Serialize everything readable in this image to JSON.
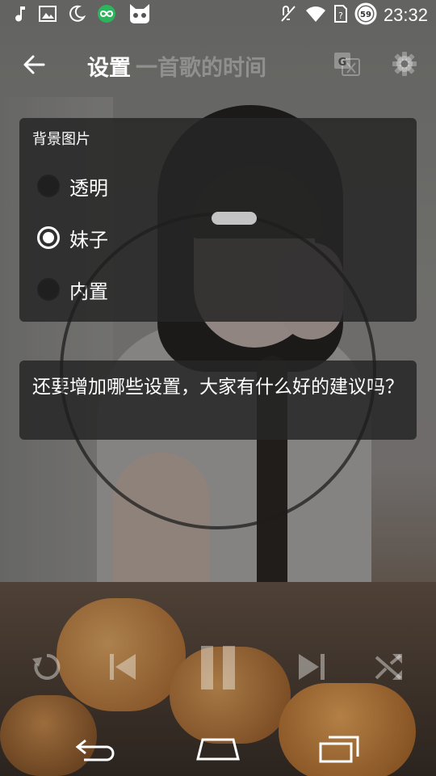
{
  "status_bar": {
    "time": "23:32",
    "battery_level": "59",
    "left_icons": [
      "music-note-icon",
      "image-icon",
      "moon-icon",
      "infinity-badge-icon",
      "robot-face-icon"
    ],
    "right_icons": [
      "mute-icon",
      "wifi-icon",
      "no-sim-icon",
      "battery-icon"
    ]
  },
  "action_bar": {
    "title": "设置",
    "subtitle": "一首歌的时间"
  },
  "background_card": {
    "header": "背景图片",
    "options": [
      {
        "label": "透明",
        "selected": false
      },
      {
        "label": "妹子",
        "selected": true
      },
      {
        "label": "内置",
        "selected": false
      }
    ]
  },
  "note_card": {
    "text": "还要增加哪些设置，大家有什么好的建议吗？"
  },
  "player_controls": [
    "replay-icon",
    "previous-icon",
    "pause-icon",
    "next-icon",
    "shuffle-icon"
  ],
  "nav_bar": [
    "back-icon",
    "home-icon",
    "recents-icon"
  ],
  "colors": {
    "card_bg": "#262626",
    "text": "#ffffff",
    "subtitle": "#ffffff47"
  }
}
